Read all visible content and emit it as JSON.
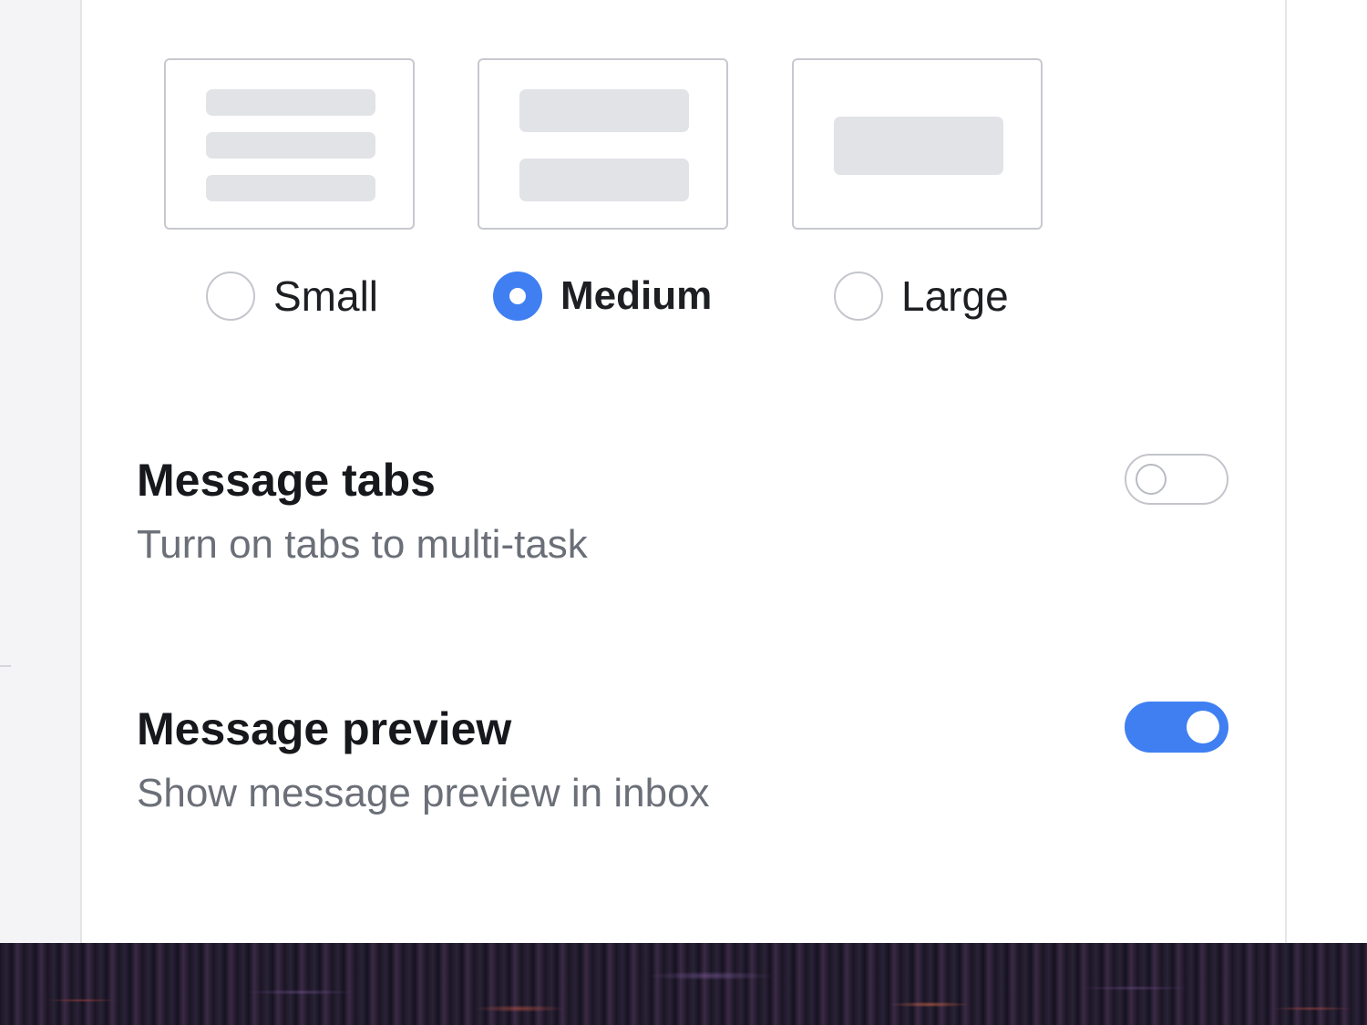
{
  "density": {
    "options": [
      {
        "label": "Small",
        "selected": false
      },
      {
        "label": "Medium",
        "selected": true
      },
      {
        "label": "Large",
        "selected": false
      }
    ]
  },
  "settings": [
    {
      "title": "Message tabs",
      "description": "Turn on tabs to multi-task",
      "enabled": false
    },
    {
      "title": "Message preview",
      "description": "Show message preview in inbox",
      "enabled": true
    }
  ],
  "colors": {
    "accent": "#3f7ff2",
    "text_primary": "#16181c",
    "text_secondary": "#6b6f78",
    "card_border": "#c7c9cf",
    "placeholder_bar": "#e1e3e7"
  }
}
